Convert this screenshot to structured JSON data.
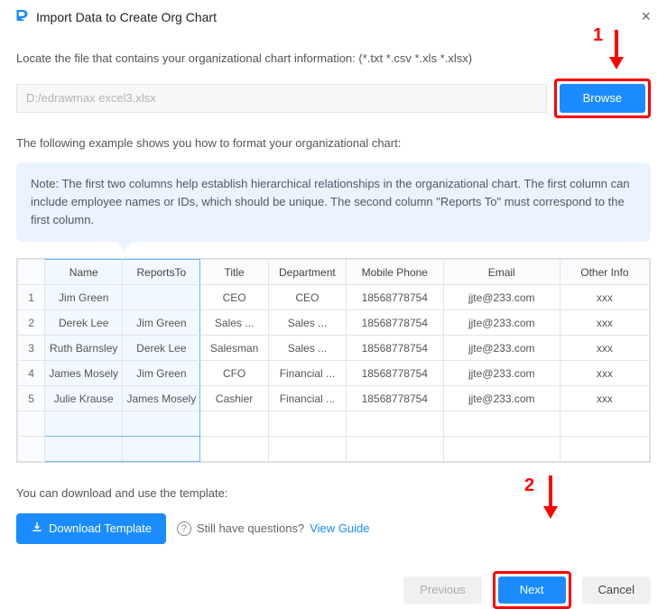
{
  "title": "Import Data to Create Org Chart",
  "locate_text": "Locate the file that contains your organizational chart information: (*.txt *.csv *.xls *.xlsx)",
  "file_value": "D:/edrawmax excel3.xlsx",
  "browse_label": "Browse",
  "example_text": "The following example shows you how to format your organizational chart:",
  "note_text": "Note: The first two columns help establish hierarchical relationships in the organizational chart. The first column can include employee names or IDs, which should be unique. The second column \"Reports To\" must correspond to the first column.",
  "table": {
    "headers": [
      "Name",
      "ReportsTo",
      "Title",
      "Department",
      "Mobile Phone",
      "Email",
      "Other Info"
    ],
    "rows": [
      {
        "idx": "1",
        "cells": [
          "Jim Green",
          "",
          "CEO",
          "CEO",
          "18568778754",
          "jjte@233.com",
          "xxx"
        ]
      },
      {
        "idx": "2",
        "cells": [
          "Derek Lee",
          "Jim Green",
          "Sales ...",
          "Sales ...",
          "18568778754",
          "jjte@233.com",
          "xxx"
        ]
      },
      {
        "idx": "3",
        "cells": [
          "Ruth Barnsley",
          "Derek Lee",
          "Salesman",
          "Sales ...",
          "18568778754",
          "jjte@233.com",
          "xxx"
        ]
      },
      {
        "idx": "4",
        "cells": [
          "James Mosely",
          "Jim Green",
          "CFO",
          "Financial ...",
          "18568778754",
          "jjte@233.com",
          "xxx"
        ]
      },
      {
        "idx": "5",
        "cells": [
          "Julie Krause",
          "James Mosely",
          "Cashier",
          "Financial ...",
          "18568778754",
          "jjte@233.com",
          "xxx"
        ]
      }
    ]
  },
  "download_text": "You can download and use the template:",
  "download_label": "Download Template",
  "help_text": "Still have questions?",
  "help_link": "View Guide",
  "prev_label": "Previous",
  "next_label": "Next",
  "cancel_label": "Cancel",
  "annotations": {
    "one": "1",
    "two": "2"
  }
}
